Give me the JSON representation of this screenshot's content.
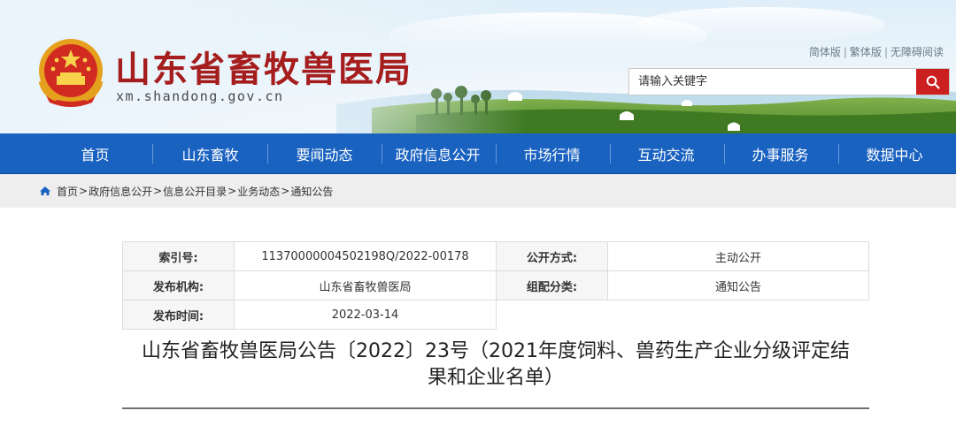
{
  "header": {
    "site_title": "山东省畜牧兽医局",
    "site_domain": "xm.shandong.gov.cn",
    "top_links": [
      "简体版",
      "繁体版",
      "无障碍阅读"
    ],
    "search": {
      "placeholder": "请输入关键字",
      "button_icon": "search-icon"
    },
    "emblem_icon": "national-emblem-icon"
  },
  "nav": {
    "items": [
      "首页",
      "山东畜牧",
      "要闻动态",
      "政府信息公开",
      "市场行情",
      "互动交流",
      "办事服务",
      "数据中心"
    ]
  },
  "breadcrumb": {
    "icon": "home-icon",
    "items": [
      "首页",
      "政府信息公开",
      "信息公开目录",
      "业务动态",
      "通知公告"
    ],
    "separator": ">"
  },
  "meta": {
    "index_label": "索引号:",
    "index_value": "11370000004502198Q/2022-00178",
    "disclosure_label": "公开方式:",
    "disclosure_value": "主动公开",
    "publisher_label": "发布机构:",
    "publisher_value": "山东省畜牧兽医局",
    "category_label": "组配分类:",
    "category_value": "通知公告",
    "date_label": "发布时间:",
    "date_value": "2022-03-14"
  },
  "article": {
    "title_line1": "山东省畜牧兽医局公告〔2022〕23号（2021年度饲料、兽药生产企业分级评定结",
    "title_line2": "果和企业名单）"
  },
  "colors": {
    "nav_bg": "#1a62c0",
    "title_red": "#a51d1d",
    "search_button": "#cc1f1f"
  }
}
